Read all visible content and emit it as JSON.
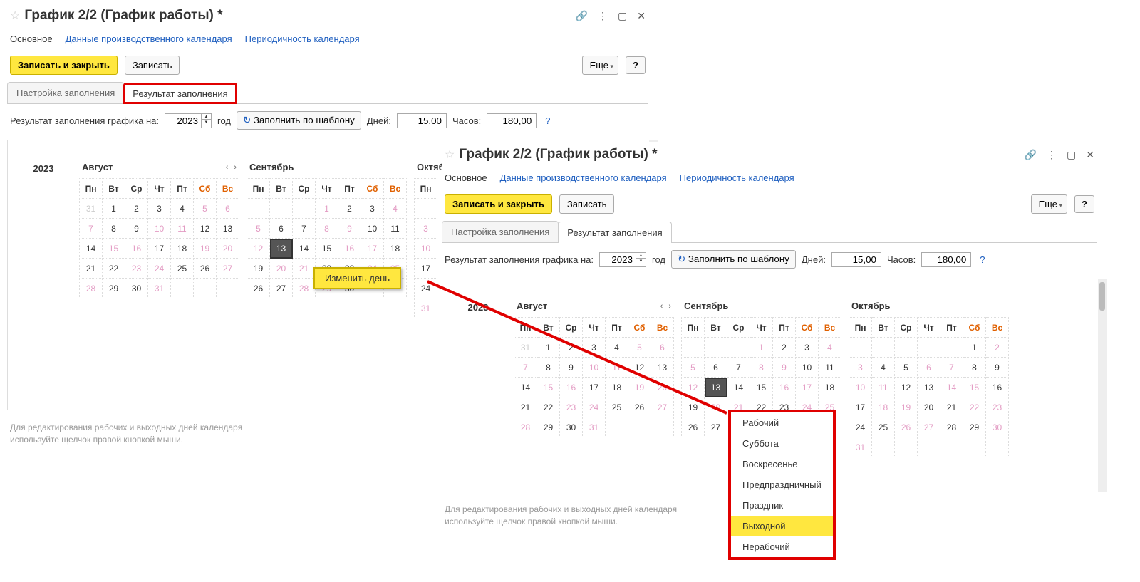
{
  "common": {
    "window_title": "График 2/2 (График работы) *",
    "nav": {
      "main": "Основное",
      "prod_data": "Данные производственного календаря",
      "periodicity": "Периодичность календаря"
    },
    "toolbar": {
      "save_close": "Записать и закрыть",
      "save": "Записать",
      "more": "Еще",
      "help": "?"
    },
    "tabs": {
      "settings": "Настройка заполнения",
      "result": "Результат заполнения"
    },
    "fill": {
      "label_prefix": "Результат заполнения графика на:",
      "year": "2023",
      "year_suffix": "год",
      "fill_by_template": "Заполнить по шаблону",
      "days_label": "Дней:",
      "days_value": "15,00",
      "hours_label": "Часов:",
      "hours_value": "180,00"
    },
    "weekdays": [
      "Пн",
      "Вт",
      "Ср",
      "Чт",
      "Пт",
      "Сб",
      "Вс"
    ],
    "year_label": "2023",
    "months": {
      "aug": "Август",
      "sep": "Сентябрь",
      "oct": "Октябрь"
    },
    "hint": {
      "line1": "Для редактирования рабочих и выходных дней календаря",
      "line2": "используйте щелчок правой кнопкой мыши."
    },
    "tooltip": "Изменить день",
    "context_menu": [
      "Рабочий",
      "Суббота",
      "Воскресенье",
      "Предпраздничный",
      "Праздник",
      "Выходной",
      "Нерабочий"
    ]
  },
  "chart_data": {
    "type": "table",
    "title": "Calendar day types for Aug-Oct 2023 (off = non-working/pink highlighted days)",
    "months": [
      {
        "name": "Август",
        "year": 2023,
        "days": 31,
        "off_days": [
          5,
          6,
          7,
          10,
          11,
          15,
          16,
          19,
          20,
          23,
          24,
          27,
          28,
          31
        ]
      },
      {
        "name": "Сентябрь",
        "year": 2023,
        "days": 30,
        "off_days": [
          1,
          4,
          5,
          8,
          9,
          12,
          16,
          17,
          20,
          21,
          24,
          25,
          28,
          29
        ],
        "selected_day": 13
      },
      {
        "name": "Октябрь",
        "year": 2023,
        "days": 31,
        "off_days": [
          2,
          3,
          6,
          7,
          10,
          11,
          14,
          15,
          18,
          19,
          22,
          23,
          26,
          27,
          30,
          31
        ]
      }
    ]
  }
}
